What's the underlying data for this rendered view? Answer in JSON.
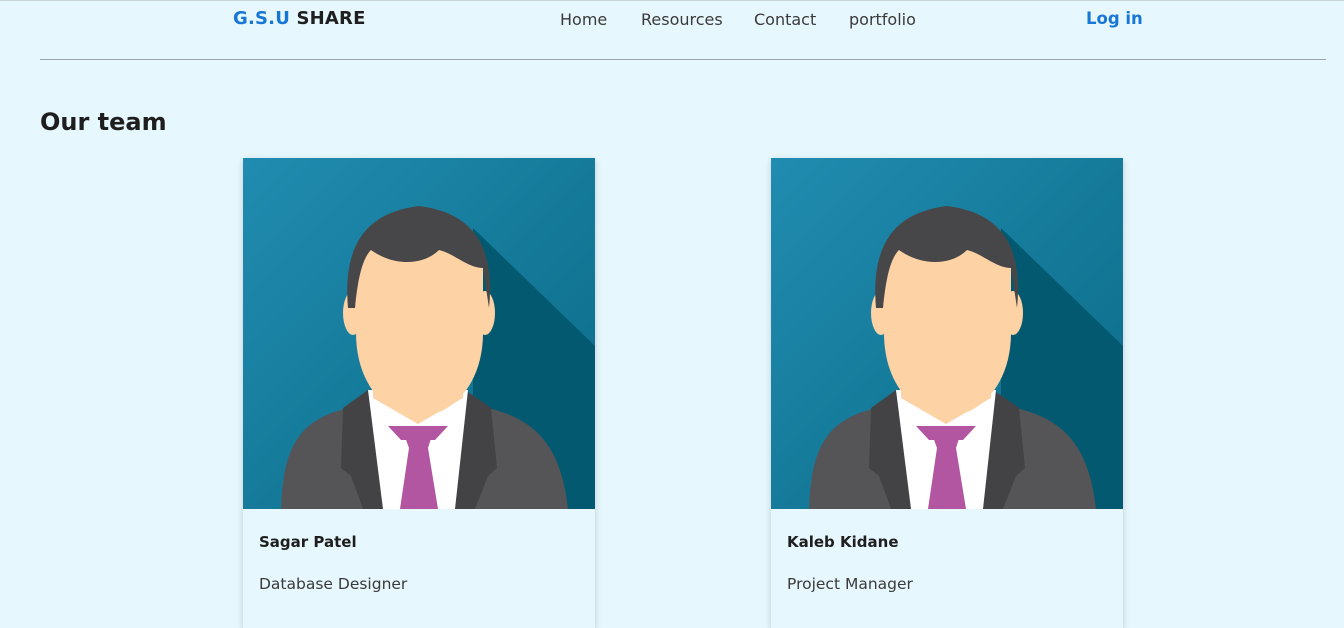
{
  "header": {
    "brand_part1": "G.S.U",
    "brand_part2": "SHARE",
    "nav": [
      "Home",
      "Resources",
      "Contact",
      "portfolio"
    ],
    "login_label": "Log in",
    "brand_color": "#1877d6"
  },
  "team": {
    "title": "Our team",
    "members": [
      {
        "name": "Sagar Patel",
        "role": "Database Designer",
        "avatar_icon": "person-avatar-icon"
      },
      {
        "name": "Kaleb Kidane",
        "role": "Project Manager",
        "avatar_icon": "person-avatar-icon"
      }
    ]
  }
}
